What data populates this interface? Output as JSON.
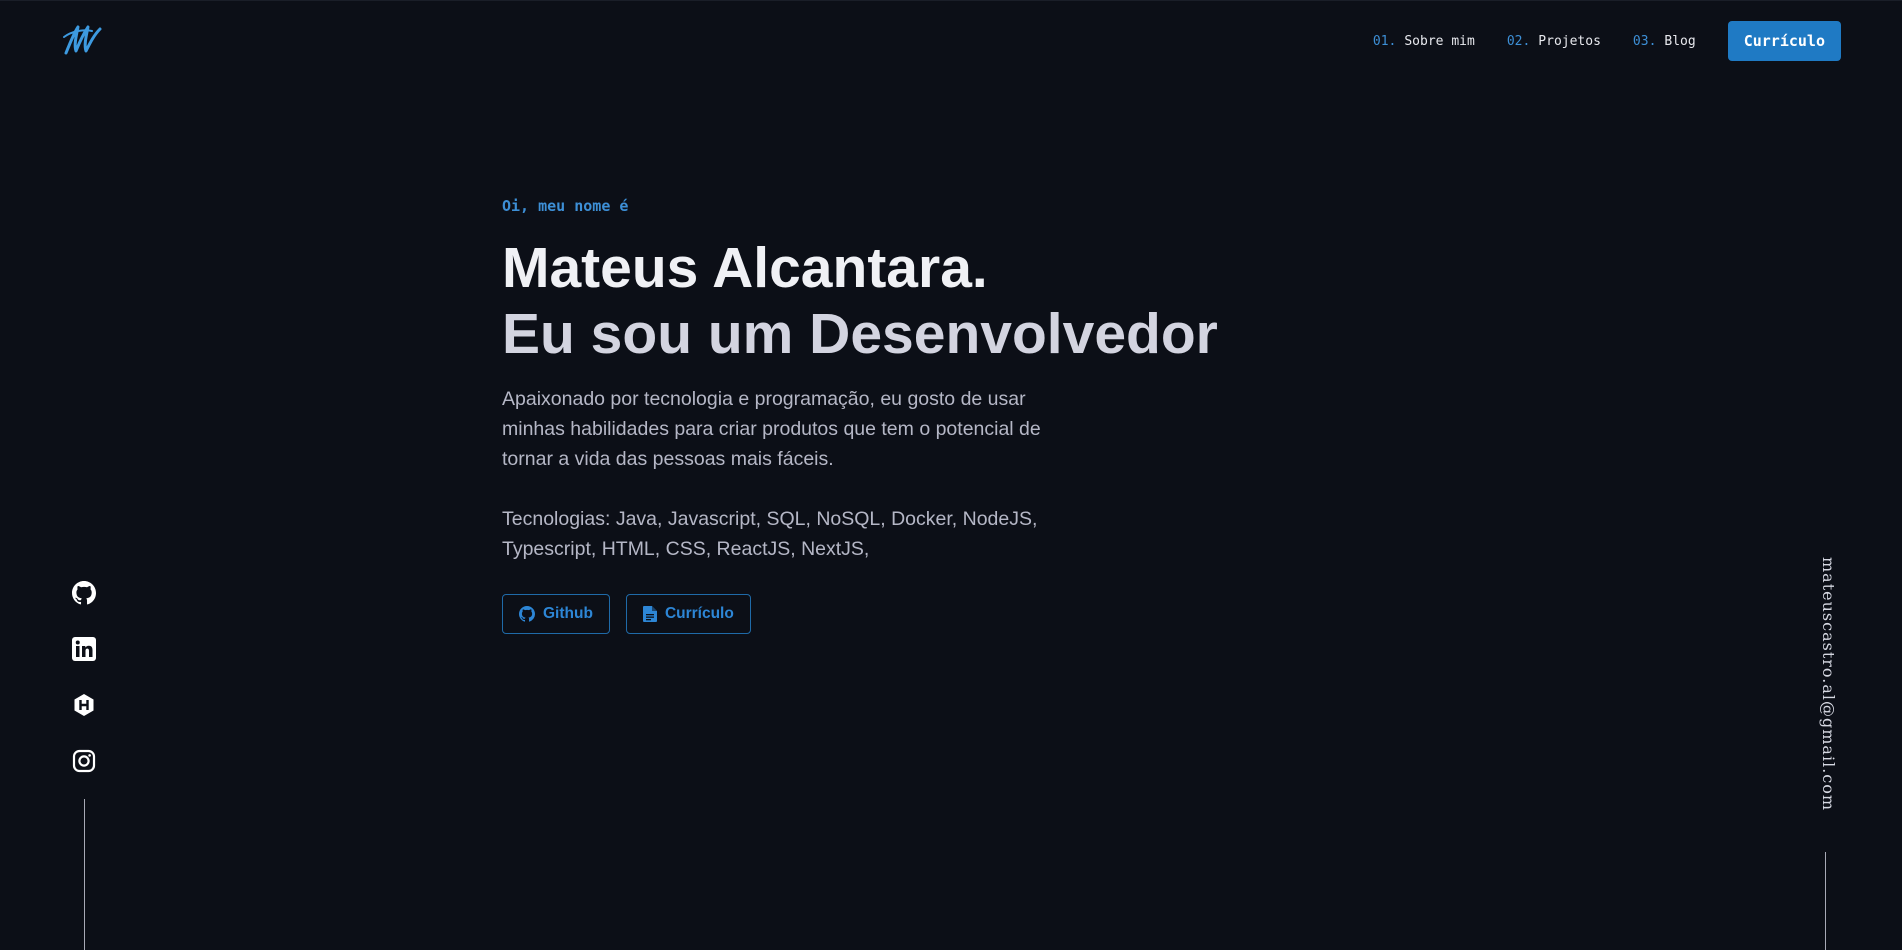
{
  "header": {
    "logo_icon": "signature-m-logo-icon",
    "nav": [
      {
        "num": "01.",
        "label": "Sobre mim"
      },
      {
        "num": "02.",
        "label": "Projetos"
      },
      {
        "num": "03.",
        "label": "Blog"
      }
    ],
    "resume_button": "Currículo"
  },
  "hero": {
    "greeting": "Oi, meu nome é",
    "name": "Mateus Alcantara.",
    "role": "Eu sou um Desenvolvedor",
    "description": "Apaixonado por tecnologia e programação, eu gosto de usar minhas habilidades para criar produtos que tem o potencial de tornar a vida das pessoas mais fáceis.",
    "technologies": "Tecnologias: Java, Javascript, SQL, NoSQL, Docker, NodeJS, Typescript, HTML, CSS, ReactJS, NextJS,",
    "buttons": {
      "github": "Github",
      "resume": "Currículo"
    }
  },
  "social": {
    "icons": [
      "github-icon",
      "linkedin-icon",
      "hackerrank-icon",
      "instagram-icon"
    ]
  },
  "email": "mateuscastro.al@gmail.com",
  "colors": {
    "background": "#0c0f17",
    "accent": "#1f7ac4",
    "accent_text": "#3d8fd6",
    "heading": "#f0f1f5",
    "body_text": "#b5b7c6"
  }
}
